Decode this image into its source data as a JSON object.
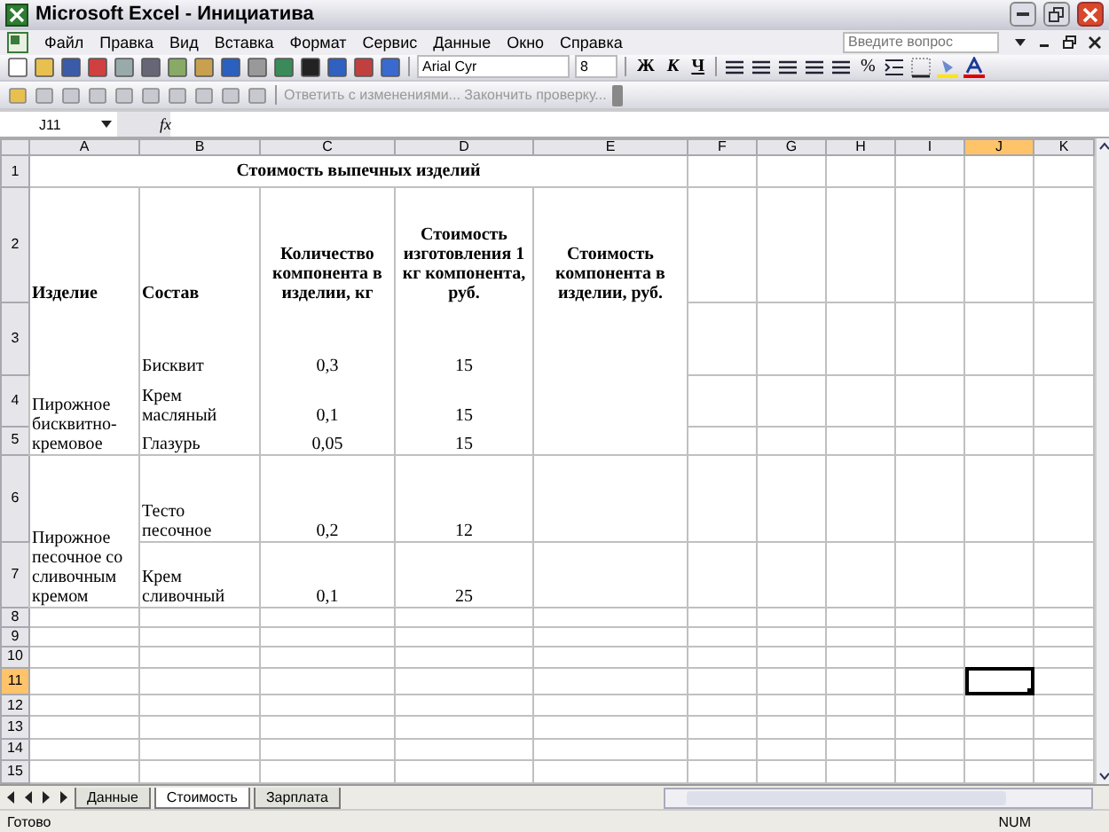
{
  "window": {
    "title": "Microsoft Excel - Инициатива"
  },
  "menu": {
    "items": [
      "Файл",
      "Правка",
      "Вид",
      "Вставка",
      "Формат",
      "Сервис",
      "Данные",
      "Окно",
      "Справка"
    ],
    "question": {
      "placeholder": "Введите вопрос"
    }
  },
  "formatting": {
    "font": "Arial Cyr",
    "size": "8",
    "bold": "Ж",
    "italic": "К",
    "underline": "Ч",
    "percent": "%"
  },
  "review_toolbar": {
    "reply": {
      "label": "Ответить с изменениями... Закончить проверку...",
      "disabled": true
    }
  },
  "formula_bar": {
    "name_box": "J11",
    "fx": "fx"
  },
  "sheet": {
    "columns": [
      {
        "label": "A",
        "selected": false
      },
      {
        "label": "B",
        "selected": false
      },
      {
        "label": "C",
        "selected": false
      },
      {
        "label": "D",
        "selected": false
      },
      {
        "label": "E",
        "selected": false
      },
      {
        "label": "F",
        "selected": false
      },
      {
        "label": "G",
        "selected": false
      },
      {
        "label": "H",
        "selected": false
      },
      {
        "label": "I",
        "selected": false
      },
      {
        "label": "J",
        "selected": true
      },
      {
        "label": "K",
        "selected": false
      }
    ],
    "rows": [
      {
        "label": "1",
        "selected": false
      },
      {
        "label": "2",
        "selected": false
      },
      {
        "label": "3",
        "selected": false
      },
      {
        "label": "4",
        "selected": false
      },
      {
        "label": "5",
        "selected": false
      },
      {
        "label": "6",
        "selected": false
      },
      {
        "label": "7",
        "selected": false
      },
      {
        "label": "8",
        "selected": false
      },
      {
        "label": "9",
        "selected": false
      },
      {
        "label": "10",
        "selected": false
      },
      {
        "label": "11",
        "selected": true
      },
      {
        "label": "12",
        "selected": false
      },
      {
        "label": "13",
        "selected": false
      },
      {
        "label": "14",
        "selected": false
      },
      {
        "label": "15",
        "selected": false
      }
    ],
    "title": "Стоимость выпечных изделий",
    "headers": [
      "Изделие",
      "Состав",
      "Количество компонента в изделии, кг",
      "Стоимость изготовления 1 кг компонента, руб.",
      "Стоимость компонента в изделии, руб."
    ],
    "products": [
      {
        "name": "Пирожное бисквитно-кремовое",
        "components": [
          {
            "name": "Бисквит",
            "qty": "0,3",
            "price": "15"
          },
          {
            "name": "Крем масляный",
            "qty": "0,1",
            "price": "15"
          },
          {
            "name": "Глазурь",
            "qty": "0,05",
            "price": "15"
          }
        ]
      },
      {
        "name": "Пирожное песочное со сливочным кремом",
        "components": [
          {
            "name": "Тесто песочное",
            "qty": "0,2",
            "price": "12"
          },
          {
            "name": "Крем сливочный",
            "qty": "0,1",
            "price": "25"
          }
        ]
      }
    ]
  },
  "sheet_tabs": [
    {
      "label": "Данные",
      "selected": false
    },
    {
      "label": "Стоимость",
      "selected": true
    },
    {
      "label": "Зарплата",
      "selected": false
    }
  ],
  "status_bar": {
    "state": "Готово",
    "num": "NUM"
  }
}
